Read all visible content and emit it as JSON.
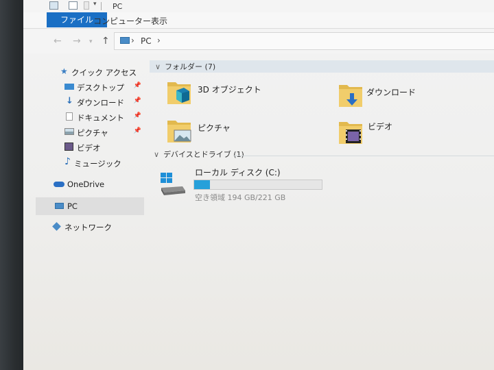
{
  "window": {
    "title": "PC"
  },
  "ribbon": {
    "tabs": [
      {
        "label": "ファイル",
        "active": true
      },
      {
        "label": "コンピューター",
        "active": false
      },
      {
        "label": "表示",
        "active": false
      }
    ]
  },
  "address": {
    "path": "PC"
  },
  "sidebar": {
    "quick_access": "クイック アクセス",
    "items": [
      {
        "label": "デスクトップ",
        "pinned": true,
        "icon": "desktop-icon"
      },
      {
        "label": "ダウンロード",
        "pinned": true,
        "icon": "download-arrow-icon"
      },
      {
        "label": "ドキュメント",
        "pinned": true,
        "icon": "document-icon"
      },
      {
        "label": "ピクチャ",
        "pinned": true,
        "icon": "picture-icon"
      },
      {
        "label": "ビデオ",
        "pinned": false,
        "icon": "video-icon"
      },
      {
        "label": "ミュージック",
        "pinned": false,
        "icon": "music-note-icon"
      }
    ],
    "onedrive": "OneDrive",
    "pc": "PC",
    "network": "ネットワーク"
  },
  "content": {
    "folders_header": "フォルダー (7)",
    "folders": [
      {
        "label": "3D オブジェクト",
        "icon": "3d-objects-folder-icon"
      },
      {
        "label": "ダウンロード",
        "icon": "downloads-folder-icon"
      },
      {
        "label": "ピクチャ",
        "icon": "pictures-folder-icon"
      },
      {
        "label": "ビデオ",
        "icon": "videos-folder-icon"
      }
    ],
    "devices_header": "デバイスとドライブ (1)",
    "drive": {
      "name": "ローカル ディスク (C:)",
      "free_text": "空き領域 194 GB/221 GB",
      "used_fraction": 0.122
    }
  },
  "colors": {
    "accent": "#1a6fc4",
    "drive_bar": "#26a0da",
    "folder_yellow": "#e8c25a"
  }
}
